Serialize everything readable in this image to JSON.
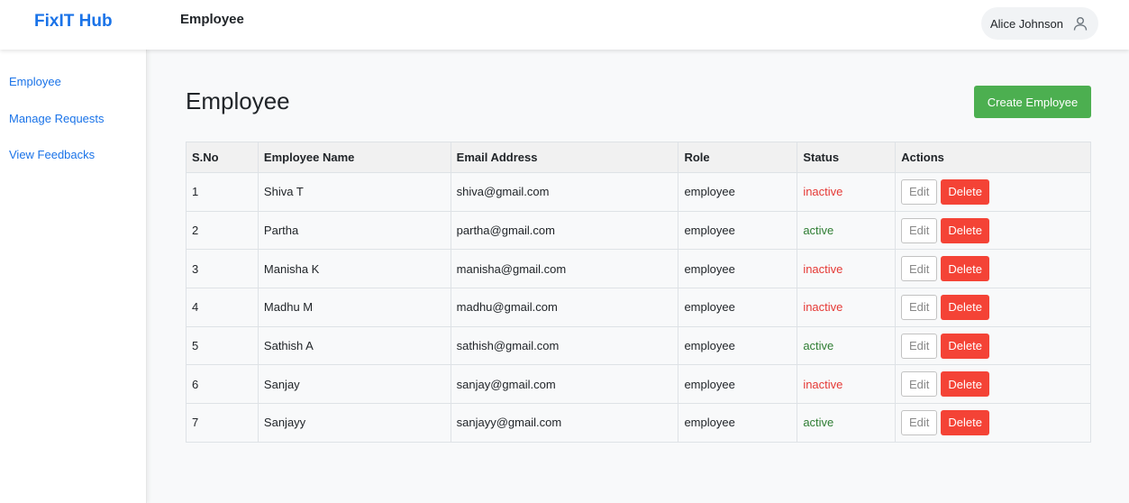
{
  "header": {
    "brand": "FixIT Hub",
    "title": "Employee",
    "user_name": "Alice Johnson",
    "user_icon": "user-icon"
  },
  "sidebar": {
    "items": [
      {
        "label": "Employee"
      },
      {
        "label": "Manage Requests"
      },
      {
        "label": "View Feedbacks"
      }
    ]
  },
  "main": {
    "title": "Employee",
    "create_label": "Create Employee",
    "table": {
      "columns": [
        "S.No",
        "Employee Name",
        "Email Address",
        "Role",
        "Status",
        "Actions"
      ],
      "rows": [
        {
          "sno": "1",
          "name": "Shiva T",
          "email": "shiva@gmail.com",
          "role": "employee",
          "status": "inactive"
        },
        {
          "sno": "2",
          "name": "Partha",
          "email": "partha@gmail.com",
          "role": "employee",
          "status": "active"
        },
        {
          "sno": "3",
          "name": "Manisha K",
          "email": "manisha@gmail.com",
          "role": "employee",
          "status": "inactive"
        },
        {
          "sno": "4",
          "name": "Madhu M",
          "email": "madhu@gmail.com",
          "role": "employee",
          "status": "inactive"
        },
        {
          "sno": "5",
          "name": "Sathish A",
          "email": "sathish@gmail.com",
          "role": "employee",
          "status": "active"
        },
        {
          "sno": "6",
          "name": "Sanjay",
          "email": "sanjay@gmail.com",
          "role": "employee",
          "status": "inactive"
        },
        {
          "sno": "7",
          "name": "Sanjayy",
          "email": "sanjayy@gmail.com",
          "role": "employee",
          "status": "active"
        }
      ],
      "edit_label": "Edit",
      "delete_label": "Delete"
    }
  },
  "colors": {
    "brand": "#1a73e8",
    "create": "#4caf50",
    "delete": "#f44336",
    "active": "#2e7d32",
    "inactive": "#e53935"
  }
}
